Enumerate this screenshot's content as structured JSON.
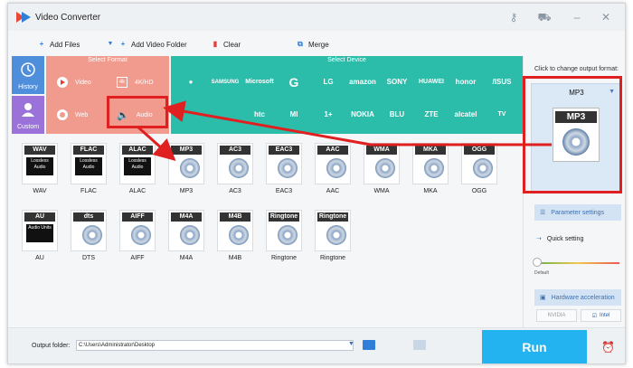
{
  "window": {
    "title": "Video Converter"
  },
  "toolbar": {
    "add_files": "Add Files",
    "add_video_folder": "Add Video Folder",
    "clear": "Clear",
    "merge": "Merge"
  },
  "categories": {
    "history": "History",
    "custom": "Custom"
  },
  "format_panel": {
    "header": "Select Format",
    "items": [
      {
        "label": "Video",
        "icon": "play-icon"
      },
      {
        "label": "4K/HD",
        "icon": "4k-icon"
      },
      {
        "label": "Web",
        "icon": "chrome-icon"
      },
      {
        "label": "Audio",
        "icon": "speaker-icon"
      }
    ]
  },
  "device_panel": {
    "header": "Select Device",
    "brands": [
      "",
      "SAMSUNG",
      "Microsoft",
      "G",
      "LG",
      "amazon",
      "SONY",
      "HUAWEI",
      "honor",
      "/ISUS",
      "",
      "",
      "htc",
      "MI",
      "1+",
      "NOKIA",
      "BLU",
      "ZTE",
      "alcatel",
      "TV"
    ]
  },
  "formats": [
    {
      "name": "WAV",
      "badge": "WAV",
      "sub": "Lossless Audio"
    },
    {
      "name": "FLAC",
      "badge": "FLAC",
      "sub": "Lossless Audio"
    },
    {
      "name": "ALAC",
      "badge": "ALAC",
      "sub": "Lossless Audio"
    },
    {
      "name": "MP3",
      "badge": "MP3",
      "sub": ""
    },
    {
      "name": "AC3",
      "badge": "AC3",
      "sub": ""
    },
    {
      "name": "EAC3",
      "badge": "EAC3",
      "sub": ""
    },
    {
      "name": "AAC",
      "badge": "AAC",
      "sub": ""
    },
    {
      "name": "WMA",
      "badge": "WMA",
      "sub": ""
    },
    {
      "name": "MKA",
      "badge": "MKA",
      "sub": ""
    },
    {
      "name": "OGG",
      "badge": "OGG",
      "sub": ""
    },
    {
      "name": "AU",
      "badge": "AU",
      "sub": "Audio Units"
    },
    {
      "name": "DTS",
      "badge": "dts",
      "sub": ""
    },
    {
      "name": "AIFF",
      "badge": "AIFF",
      "sub": ""
    },
    {
      "name": "M4A",
      "badge": "M4A",
      "sub": ""
    },
    {
      "name": "M4B",
      "badge": "M4B",
      "sub": ""
    },
    {
      "name": "Ringtone",
      "badge": "Ringtone",
      "sub": ""
    },
    {
      "name": "Ringtone",
      "badge": "Ringtone",
      "sub": ""
    }
  ],
  "right_panel": {
    "hint": "Click to change output format:",
    "output_format": "MP3",
    "output_badge": "MP3",
    "parameter_settings": "Parameter settings",
    "quick_setting": "Quick setting",
    "default_label": "Default",
    "hardware_acceleration": "Hardware acceleration",
    "nvidia": "NVIDIA",
    "intel": "Intel"
  },
  "bottom": {
    "output_folder_label": "Output folder:",
    "output_folder_value": "C:\\Users\\Administrator\\Desktop",
    "run": "Run"
  },
  "colors": {
    "format_panel": "#f09b8e",
    "device_panel": "#2cbcaa",
    "run": "#23b3f0",
    "annotation": "#e02020"
  }
}
